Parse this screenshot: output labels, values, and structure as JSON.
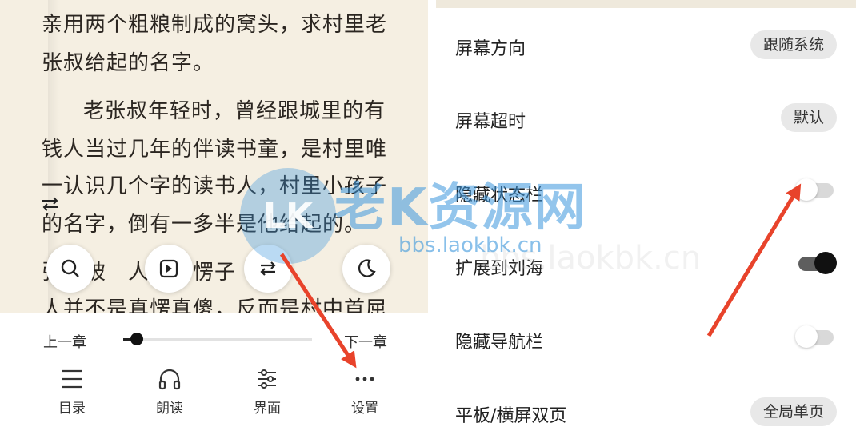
{
  "reader": {
    "lines": [
      "亲用两个粗粮制成的窝头，求村里老",
      "张叔给起的名字。",
      "老张叔年轻时，曾经跟城里的有",
      "钱人当过几年的伴读书童，是村里唯",
      "一认识几个字的读书人，村里小孩子",
      "的名字，倒有一多半是他给起的。",
      "张立被　人叫　愣子　",
      "人并不是真愣真傻，反而是村中首屈"
    ],
    "chapter_prev": "上一章",
    "chapter_next": "下一章",
    "progress": 0.07,
    "nav": [
      {
        "label": "目录",
        "icon": "list-icon"
      },
      {
        "label": "朗读",
        "icon": "headphones-icon"
      },
      {
        "label": "界面",
        "icon": "sliders-icon"
      },
      {
        "label": "设置",
        "icon": "more-icon"
      }
    ],
    "fabs": [
      "search-icon",
      "play-icon",
      "repeat-icon",
      "moon-icon"
    ]
  },
  "settings": {
    "rows": [
      {
        "label": "屏幕方向",
        "control": "pill",
        "value": "跟随系统"
      },
      {
        "label": "屏幕超时",
        "control": "pill",
        "value": "默认"
      },
      {
        "label": "隐藏状态栏",
        "control": "toggle",
        "on": false
      },
      {
        "label": "扩展到刘海",
        "control": "toggle",
        "on": true
      },
      {
        "label": "隐藏导航栏",
        "control": "toggle",
        "on": false
      },
      {
        "label": "平板/横屏双页",
        "control": "pill",
        "value": "全局单页"
      }
    ]
  },
  "watermark": {
    "logo_text": "LK",
    "title": "老K资源网",
    "url": "bbs.laokbk.cn"
  },
  "colors": {
    "page_bg": "#f5efe2",
    "arrow": "#e8432b",
    "watermark": "#3a96dc"
  }
}
